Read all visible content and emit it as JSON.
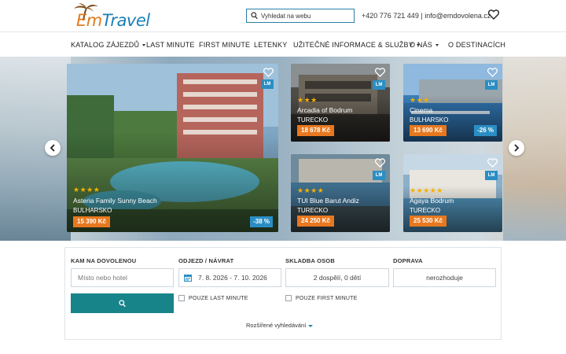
{
  "brand": {
    "logo_text_em": "Em",
    "logo_text_travel": "Travel",
    "color_primary": "#1a7fb8",
    "color_accent": "#e8781f",
    "color_button": "#17848a"
  },
  "header": {
    "search_placeholder": "Vyhledat na webu",
    "phone": "+420 776 721 449",
    "separator": "|",
    "email": "info@emdovolena.cz",
    "heart_icon": "heart-outline-icon"
  },
  "nav": {
    "items": [
      {
        "label": "KATALOG ZÁJEZDŮ",
        "dropdown": true
      },
      {
        "label": "LAST MINUTE",
        "dropdown": false
      },
      {
        "label": "FIRST MINUTE",
        "dropdown": false
      },
      {
        "label": "LETENKY",
        "dropdown": false
      },
      {
        "label": "UŽITEČNÉ INFORMACE & SLUŽBY",
        "dropdown": true
      },
      {
        "label": "O NÁS",
        "dropdown": true
      },
      {
        "label": "O DESTINACÍCH",
        "dropdown": false
      }
    ]
  },
  "hero": {
    "cards": [
      {
        "name": "Asteria Family Sunny Beach",
        "country": "BULHARSKO",
        "stars": "★★★★",
        "price": "15 390 Kč",
        "discount": "-38 %",
        "badge": "LM"
      },
      {
        "name": "Arcadia of Bodrum",
        "country": "TURECKO",
        "stars": "★★★",
        "price": "18 678 Kč",
        "discount": "",
        "badge": "LM"
      },
      {
        "name": "Cinema",
        "country": "BULHARSKO",
        "stars": "★★★",
        "price": "13 690 Kč",
        "discount": "-26 %",
        "badge": "LM"
      },
      {
        "name": "TUI Blue Barut Andiz",
        "country": "TURECKO",
        "stars": "★★★★",
        "price": "24 250 Kč",
        "discount": "",
        "badge": "LM"
      },
      {
        "name": "Agaya Bodrum",
        "country": "TURECKO",
        "stars": "★★★★★",
        "price": "25 530 Kč",
        "discount": "",
        "badge": "LM"
      }
    ]
  },
  "search": {
    "where_label": "KAM NA DOVOLENOU",
    "where_placeholder": "Místo nebo hotel",
    "dates_label": "ODJEZD / NÁVRAT",
    "dates_value": "7. 8. 2026 - 7. 10. 2026",
    "persons_label": "SKLADBA OSOB",
    "persons_value": "2 dospělí, 0 dětí",
    "transport_label": "DOPRAVA",
    "transport_value": "nerozhoduje",
    "last_minute_label": "POUZE LAST MINUTE",
    "first_minute_label": "POUZE FIRST MINUTE",
    "advanced_label": "Rozšířené vyhledávání"
  }
}
